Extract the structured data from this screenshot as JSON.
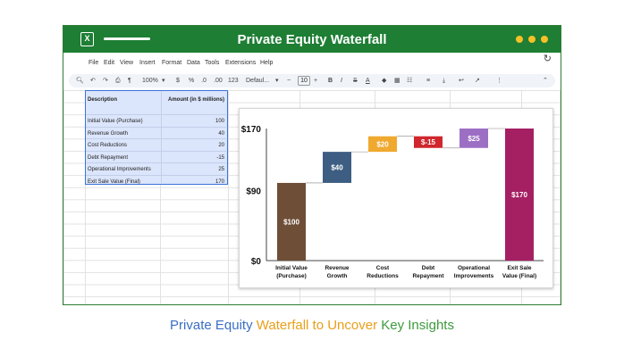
{
  "app": {
    "title": "Private Equity Waterfall",
    "logo_letter": "X"
  },
  "menu": [
    "File",
    "Edit",
    "View",
    "Insert",
    "Format",
    "Data",
    "Tools",
    "Extensions",
    "Help"
  ],
  "toolbar": {
    "zoom": "100%",
    "currency": "$",
    "percent": "%",
    "dec_down": ".0",
    "dec_up": ".00",
    "number_format": "123",
    "font": "Defaul...",
    "font_size": "10",
    "bold": "B",
    "italic": "I",
    "text_color": "A"
  },
  "sheet": {
    "headers": {
      "description": "Description",
      "amount": "Amount (in $ millions)"
    },
    "rows": [
      {
        "description": "Initial Value (Purchase)",
        "amount": "100"
      },
      {
        "description": "Revenue Growth",
        "amount": "40"
      },
      {
        "description": "Cost Reductions",
        "amount": "20"
      },
      {
        "description": "Debt Repayment",
        "amount": "-15"
      },
      {
        "description": "Operational Improvements",
        "amount": "25"
      },
      {
        "description": "Exit Sale Value (Final)",
        "amount": "170"
      }
    ]
  },
  "chart_data": {
    "type": "bar",
    "subtype": "waterfall",
    "categories": [
      "Initial Value (Purchase)",
      "Revenue Growth",
      "Cost Reductions",
      "Debt Repayment",
      "Operational Improvements",
      "Exit Sale Value (Final)"
    ],
    "category_lines": [
      [
        "Initial Value",
        "(Purchase)"
      ],
      [
        "Revenue",
        "Growth"
      ],
      [
        "Cost",
        "Reductions"
      ],
      [
        "Debt",
        "Repayment"
      ],
      [
        "Operational",
        "Improvements"
      ],
      [
        "Exit Sale",
        "Value (Final)"
      ]
    ],
    "values": [
      100,
      40,
      20,
      -15,
      25,
      170
    ],
    "bases": [
      0,
      100,
      140,
      160,
      145,
      0
    ],
    "data_labels": [
      "$100",
      "$40",
      "$20",
      "$-15",
      "$25",
      "$170"
    ],
    "colors": [
      "#6e4e37",
      "#3d5e82",
      "#f0a92f",
      "#d0262d",
      "#9c6fc4",
      "#a51f63"
    ],
    "y_ticks": [
      0,
      90,
      170
    ],
    "y_tick_labels": [
      "$0",
      "$90",
      "$170"
    ],
    "ylim": [
      0,
      170
    ],
    "grid": false,
    "legend": "none"
  },
  "caption": {
    "part1": "Private Equity",
    "part2": "Waterfall to Uncover",
    "part3": "Key Insights"
  }
}
